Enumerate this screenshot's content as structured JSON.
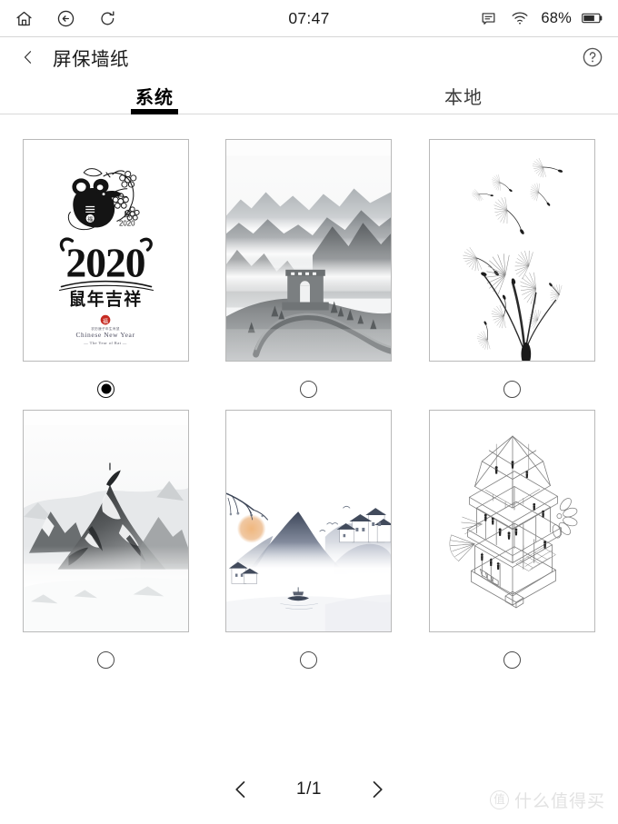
{
  "statusbar": {
    "clock": "07:47",
    "battery_percent": "68%",
    "icons": {
      "home": "home-icon",
      "back": "back-circle-icon",
      "refresh": "refresh-icon",
      "notes": "notes-icon",
      "wifi": "wifi-icon",
      "battery": "battery-icon"
    }
  },
  "header": {
    "back_label": "‹",
    "title": "屏保墙纸",
    "help_label": "?"
  },
  "tabs": [
    {
      "label": "系统",
      "active": true
    },
    {
      "label": "本地",
      "active": false
    }
  ],
  "wallpapers": [
    {
      "name": "new-year-2020-rat",
      "description": "2020 鼠年吉祥 Chinese New Year Year of the Rat poster",
      "selected": true,
      "captions": {
        "year": "2020",
        "greeting": "鼠年吉祥",
        "zodiac_small": "鼠",
        "zodiac_year": "2020",
        "subtitle_cn": "农历庚子年生肖鼠",
        "subtitle_en": "Chinese New Year",
        "subtitle_en2": "The Year of Rat"
      }
    },
    {
      "name": "great-wall-mist",
      "description": "Great Wall watchtower among misty mountains, ink-wash grayscale",
      "selected": false
    },
    {
      "name": "dandelion-seeds",
      "description": "Dandelion seeds drifting, fine line illustration",
      "selected": false
    },
    {
      "name": "snow-mountain-peak",
      "description": "Snow covered mountain peak in black and white photography",
      "selected": false
    },
    {
      "name": "ink-landscape-village",
      "description": "Chinese ink landscape with sun, village houses and a boat",
      "selected": false
    },
    {
      "name": "isometric-house-lineart",
      "description": "Isometric cutaway line drawing of a multi-storey house",
      "selected": false
    }
  ],
  "pager": {
    "prev_label": "‹",
    "page_label": "1/1",
    "next_label": "›"
  },
  "watermark": {
    "badge": "值",
    "text": "什么值得买"
  },
  "colors": {
    "accent": "#000000",
    "text": "#1a1a1a",
    "border": "#b9b9b9",
    "divider": "#d9d9d9",
    "watermark": "#e2e2e2"
  }
}
